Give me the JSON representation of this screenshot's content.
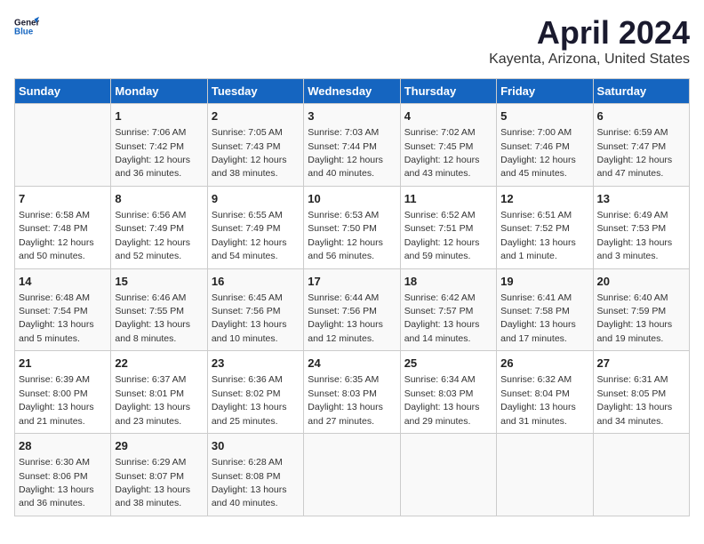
{
  "header": {
    "logo_general": "General",
    "logo_blue": "Blue",
    "title": "April 2024",
    "subtitle": "Kayenta, Arizona, United States"
  },
  "calendar": {
    "days_of_week": [
      "Sunday",
      "Monday",
      "Tuesday",
      "Wednesday",
      "Thursday",
      "Friday",
      "Saturday"
    ],
    "weeks": [
      [
        {
          "day": "",
          "info": ""
        },
        {
          "day": "1",
          "info": "Sunrise: 7:06 AM\nSunset: 7:42 PM\nDaylight: 12 hours\nand 36 minutes."
        },
        {
          "day": "2",
          "info": "Sunrise: 7:05 AM\nSunset: 7:43 PM\nDaylight: 12 hours\nand 38 minutes."
        },
        {
          "day": "3",
          "info": "Sunrise: 7:03 AM\nSunset: 7:44 PM\nDaylight: 12 hours\nand 40 minutes."
        },
        {
          "day": "4",
          "info": "Sunrise: 7:02 AM\nSunset: 7:45 PM\nDaylight: 12 hours\nand 43 minutes."
        },
        {
          "day": "5",
          "info": "Sunrise: 7:00 AM\nSunset: 7:46 PM\nDaylight: 12 hours\nand 45 minutes."
        },
        {
          "day": "6",
          "info": "Sunrise: 6:59 AM\nSunset: 7:47 PM\nDaylight: 12 hours\nand 47 minutes."
        }
      ],
      [
        {
          "day": "7",
          "info": "Sunrise: 6:58 AM\nSunset: 7:48 PM\nDaylight: 12 hours\nand 50 minutes."
        },
        {
          "day": "8",
          "info": "Sunrise: 6:56 AM\nSunset: 7:49 PM\nDaylight: 12 hours\nand 52 minutes."
        },
        {
          "day": "9",
          "info": "Sunrise: 6:55 AM\nSunset: 7:49 PM\nDaylight: 12 hours\nand 54 minutes."
        },
        {
          "day": "10",
          "info": "Sunrise: 6:53 AM\nSunset: 7:50 PM\nDaylight: 12 hours\nand 56 minutes."
        },
        {
          "day": "11",
          "info": "Sunrise: 6:52 AM\nSunset: 7:51 PM\nDaylight: 12 hours\nand 59 minutes."
        },
        {
          "day": "12",
          "info": "Sunrise: 6:51 AM\nSunset: 7:52 PM\nDaylight: 13 hours\nand 1 minute."
        },
        {
          "day": "13",
          "info": "Sunrise: 6:49 AM\nSunset: 7:53 PM\nDaylight: 13 hours\nand 3 minutes."
        }
      ],
      [
        {
          "day": "14",
          "info": "Sunrise: 6:48 AM\nSunset: 7:54 PM\nDaylight: 13 hours\nand 5 minutes."
        },
        {
          "day": "15",
          "info": "Sunrise: 6:46 AM\nSunset: 7:55 PM\nDaylight: 13 hours\nand 8 minutes."
        },
        {
          "day": "16",
          "info": "Sunrise: 6:45 AM\nSunset: 7:56 PM\nDaylight: 13 hours\nand 10 minutes."
        },
        {
          "day": "17",
          "info": "Sunrise: 6:44 AM\nSunset: 7:56 PM\nDaylight: 13 hours\nand 12 minutes."
        },
        {
          "day": "18",
          "info": "Sunrise: 6:42 AM\nSunset: 7:57 PM\nDaylight: 13 hours\nand 14 minutes."
        },
        {
          "day": "19",
          "info": "Sunrise: 6:41 AM\nSunset: 7:58 PM\nDaylight: 13 hours\nand 17 minutes."
        },
        {
          "day": "20",
          "info": "Sunrise: 6:40 AM\nSunset: 7:59 PM\nDaylight: 13 hours\nand 19 minutes."
        }
      ],
      [
        {
          "day": "21",
          "info": "Sunrise: 6:39 AM\nSunset: 8:00 PM\nDaylight: 13 hours\nand 21 minutes."
        },
        {
          "day": "22",
          "info": "Sunrise: 6:37 AM\nSunset: 8:01 PM\nDaylight: 13 hours\nand 23 minutes."
        },
        {
          "day": "23",
          "info": "Sunrise: 6:36 AM\nSunset: 8:02 PM\nDaylight: 13 hours\nand 25 minutes."
        },
        {
          "day": "24",
          "info": "Sunrise: 6:35 AM\nSunset: 8:03 PM\nDaylight: 13 hours\nand 27 minutes."
        },
        {
          "day": "25",
          "info": "Sunrise: 6:34 AM\nSunset: 8:03 PM\nDaylight: 13 hours\nand 29 minutes."
        },
        {
          "day": "26",
          "info": "Sunrise: 6:32 AM\nSunset: 8:04 PM\nDaylight: 13 hours\nand 31 minutes."
        },
        {
          "day": "27",
          "info": "Sunrise: 6:31 AM\nSunset: 8:05 PM\nDaylight: 13 hours\nand 34 minutes."
        }
      ],
      [
        {
          "day": "28",
          "info": "Sunrise: 6:30 AM\nSunset: 8:06 PM\nDaylight: 13 hours\nand 36 minutes."
        },
        {
          "day": "29",
          "info": "Sunrise: 6:29 AM\nSunset: 8:07 PM\nDaylight: 13 hours\nand 38 minutes."
        },
        {
          "day": "30",
          "info": "Sunrise: 6:28 AM\nSunset: 8:08 PM\nDaylight: 13 hours\nand 40 minutes."
        },
        {
          "day": "",
          "info": ""
        },
        {
          "day": "",
          "info": ""
        },
        {
          "day": "",
          "info": ""
        },
        {
          "day": "",
          "info": ""
        }
      ]
    ]
  }
}
